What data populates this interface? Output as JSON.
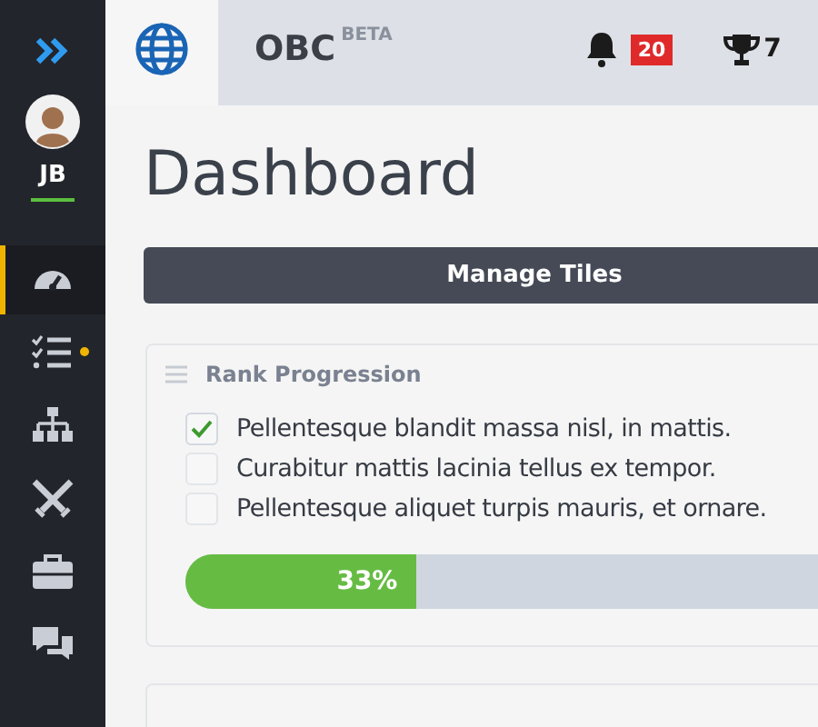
{
  "sidebar": {
    "user_initials": "JB",
    "items": [
      {
        "selected": true,
        "has_dot": false
      },
      {
        "selected": false,
        "has_dot": true
      },
      {
        "selected": false,
        "has_dot": false
      },
      {
        "selected": false,
        "has_dot": false
      },
      {
        "selected": false,
        "has_dot": false
      },
      {
        "selected": false,
        "has_dot": false
      }
    ]
  },
  "header": {
    "app_name": "OBC",
    "app_tag": "BETA",
    "notification_count": "20",
    "trophy_count": "7"
  },
  "page": {
    "title": "Dashboard",
    "manage_button": "Manage Tiles"
  },
  "card": {
    "title": "Rank Progression",
    "tasks": [
      {
        "label": "Pellentesque blandit massa nisl, in mattis.",
        "checked": true
      },
      {
        "label": "Curabitur mattis lacinia tellus ex tempor.",
        "checked": false
      },
      {
        "label": "Pellentesque aliquet turpis mauris, et ornare.",
        "checked": false
      }
    ],
    "progress": {
      "level": 0.33,
      "reading": "33%"
    }
  }
}
